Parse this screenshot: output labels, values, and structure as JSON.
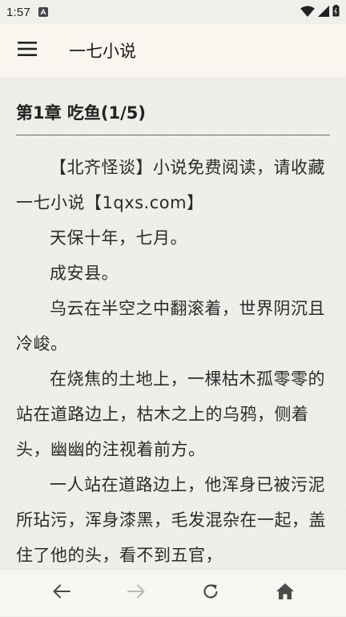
{
  "status_bar": {
    "time": "1:57"
  },
  "app_bar": {
    "title": "一七小说",
    "menu_icon": "hamburger-menu-icon"
  },
  "chapter": {
    "title": "第1章 吃鱼(1/5)",
    "paragraphs": [
      "【北齐怪谈】小说免费阅读，请收藏　一七小说【1qxs.com】",
      "天保十年，七月。",
      "成安县。",
      "乌云在半空之中翻滚着，世界阴沉且冷峻。",
      "在烧焦的土地上，一棵枯木孤零零的站在道路边上，枯木之上的乌鸦，侧着头，幽幽的注视着前方。",
      "一人站在道路边上，他浑身已被污泥所玷污，浑身漆黑，毛发混杂在一起，盖住了他的头，看不到五官，"
    ]
  },
  "bottom_nav": {
    "back_icon": "arrow-left-icon",
    "forward_icon": "arrow-right-icon",
    "refresh_icon": "refresh-icon",
    "home_icon": "home-icon"
  },
  "colors": {
    "background": "#f0eee9",
    "app_bar": "#f8f6ef",
    "text": "#2b2b2b",
    "nav_icon_active": "#4a4a4a",
    "nav_icon_disabled": "#b8b8b8"
  }
}
